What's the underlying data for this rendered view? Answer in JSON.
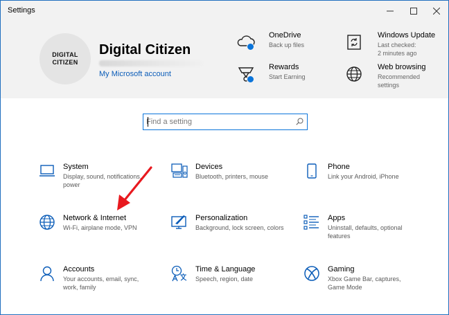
{
  "window": {
    "title": "Settings"
  },
  "account": {
    "avatar_line1": "DIGITAL",
    "avatar_line2": "CITIZEN",
    "name": "Digital Citizen",
    "link": "My Microsoft account"
  },
  "header_items": [
    {
      "title": "OneDrive",
      "subtitle": "Back up files",
      "icon": "onedrive-cloud-icon"
    },
    {
      "title": "Windows Update",
      "subtitle": "Last checked: 2 minutes ago",
      "icon": "update-sync-icon"
    },
    {
      "title": "Rewards",
      "subtitle": "Start Earning",
      "icon": "rewards-trophy-icon"
    },
    {
      "title": "Web browsing",
      "subtitle": "Recommended settings",
      "icon": "globe-icon"
    }
  ],
  "search": {
    "placeholder": "Find a setting"
  },
  "categories": [
    {
      "title": "System",
      "desc": "Display, sound, notifications, power",
      "icon": "laptop-icon"
    },
    {
      "title": "Devices",
      "desc": "Bluetooth, printers, mouse",
      "icon": "devices-icon"
    },
    {
      "title": "Phone",
      "desc": "Link your Android, iPhone",
      "icon": "phone-icon"
    },
    {
      "title": "Network & Internet",
      "desc": "Wi-Fi, airplane mode, VPN",
      "icon": "globe-icon"
    },
    {
      "title": "Personalization",
      "desc": "Background, lock screen, colors",
      "icon": "paint-monitor-icon"
    },
    {
      "title": "Apps",
      "desc": "Uninstall, defaults, optional features",
      "icon": "apps-list-icon"
    },
    {
      "title": "Accounts",
      "desc": "Your accounts, email, sync, work, family",
      "icon": "person-icon"
    },
    {
      "title": "Time & Language",
      "desc": "Speech, region, date",
      "icon": "time-language-icon"
    },
    {
      "title": "Gaming",
      "desc": "Xbox Game Bar, captures, Game Mode",
      "icon": "xbox-icon"
    }
  ],
  "colors": {
    "accent": "#0a74da",
    "header_bg": "#f2f2f2",
    "annotation_arrow": "#e8191f"
  }
}
